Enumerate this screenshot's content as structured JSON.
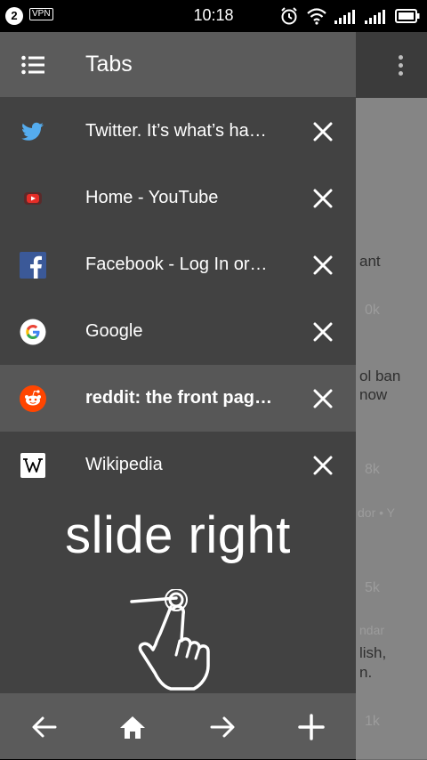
{
  "status_bar": {
    "notification_count": "2",
    "vpn_label": "VPN",
    "time": "10:18",
    "icons": [
      "alarm-icon",
      "wifi-icon",
      "signal-1-icon",
      "signal-2-icon",
      "battery-icon"
    ]
  },
  "drawer": {
    "title": "Tabs",
    "tabs": [
      {
        "title": "Twitter. It’s what’s ha…",
        "favicon": "twitter-icon",
        "active": false
      },
      {
        "title": "Home - YouTube",
        "favicon": "youtube-icon",
        "active": false
      },
      {
        "title": "Facebook - Log In or…",
        "favicon": "facebook-icon",
        "active": false
      },
      {
        "title": "Google",
        "favicon": "google-icon",
        "active": false
      },
      {
        "title": "reddit: the front pag…",
        "favicon": "reddit-icon",
        "active": true
      },
      {
        "title": "Wikipedia",
        "favicon": "wikipedia-icon",
        "active": false
      }
    ],
    "hint_text": "slide right"
  },
  "bottom_bar": {
    "buttons": [
      "back-icon",
      "home-icon",
      "forward-icon",
      "new-tab-icon"
    ]
  },
  "background_page": {
    "snippets": [
      "ant",
      "ol ban",
      "now",
      "lish,",
      "n."
    ],
    "vote_counts": [
      "0k",
      "8k",
      "5k",
      "1k"
    ],
    "faded_labels": [
      "dor • Y",
      "ndar"
    ]
  },
  "colors": {
    "drawer_bg": "#424242",
    "header_bg": "#5b5b5b",
    "active_tab_bg": "#575757",
    "twitter": "#55acee",
    "youtube": "#e52d27",
    "facebook": "#3b5998",
    "reddit": "#ff4500"
  }
}
